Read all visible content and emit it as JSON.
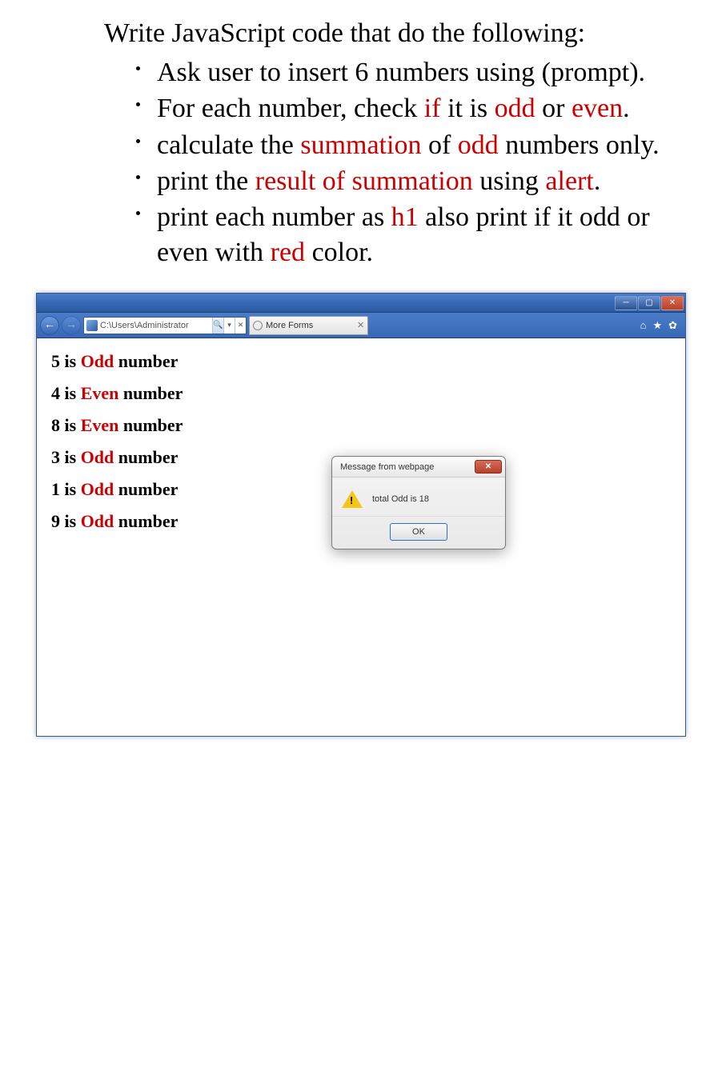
{
  "task": {
    "title": "Write JavaScript code that do the following:",
    "bullets": [
      {
        "pre": "Ask user to insert 6 numbers using (prompt)."
      },
      {
        "pre": "For each number, check ",
        "hl1": "if",
        "mid1": " it is ",
        "hl2": "odd",
        "mid2": " or ",
        "hl3": "even",
        "post": "."
      },
      {
        "pre": "calculate the ",
        "hl1": "summation",
        "mid1": " of ",
        "hl2": "odd",
        "post": " numbers only."
      },
      {
        "pre": "print the ",
        "hl1": "result of summation",
        "mid1": " using ",
        "hl2": "alert",
        "post": "."
      },
      {
        "pre": "print each number as ",
        "hl1": "h1",
        "mid1": " also print if it odd or even with ",
        "hl2": "red",
        "post": " color."
      }
    ]
  },
  "browser": {
    "address": "C:\\Users\\Administrator",
    "tab_title": "More Forms"
  },
  "output": {
    "lines": [
      {
        "num": "5",
        "word": "is",
        "kind": "Odd",
        "suffix": "number"
      },
      {
        "num": "4",
        "word": "is",
        "kind": "Even",
        "suffix": "number"
      },
      {
        "num": "8",
        "word": "is",
        "kind": "Even",
        "suffix": "number"
      },
      {
        "num": "3",
        "word": "is",
        "kind": "Odd",
        "suffix": "number"
      },
      {
        "num": "1",
        "word": "is",
        "kind": "Odd",
        "suffix": "number"
      },
      {
        "num": "9",
        "word": "is",
        "kind": "Odd",
        "suffix": "number"
      }
    ]
  },
  "alert": {
    "title": "Message from webpage",
    "message": "total Odd is 18",
    "ok": "OK"
  }
}
